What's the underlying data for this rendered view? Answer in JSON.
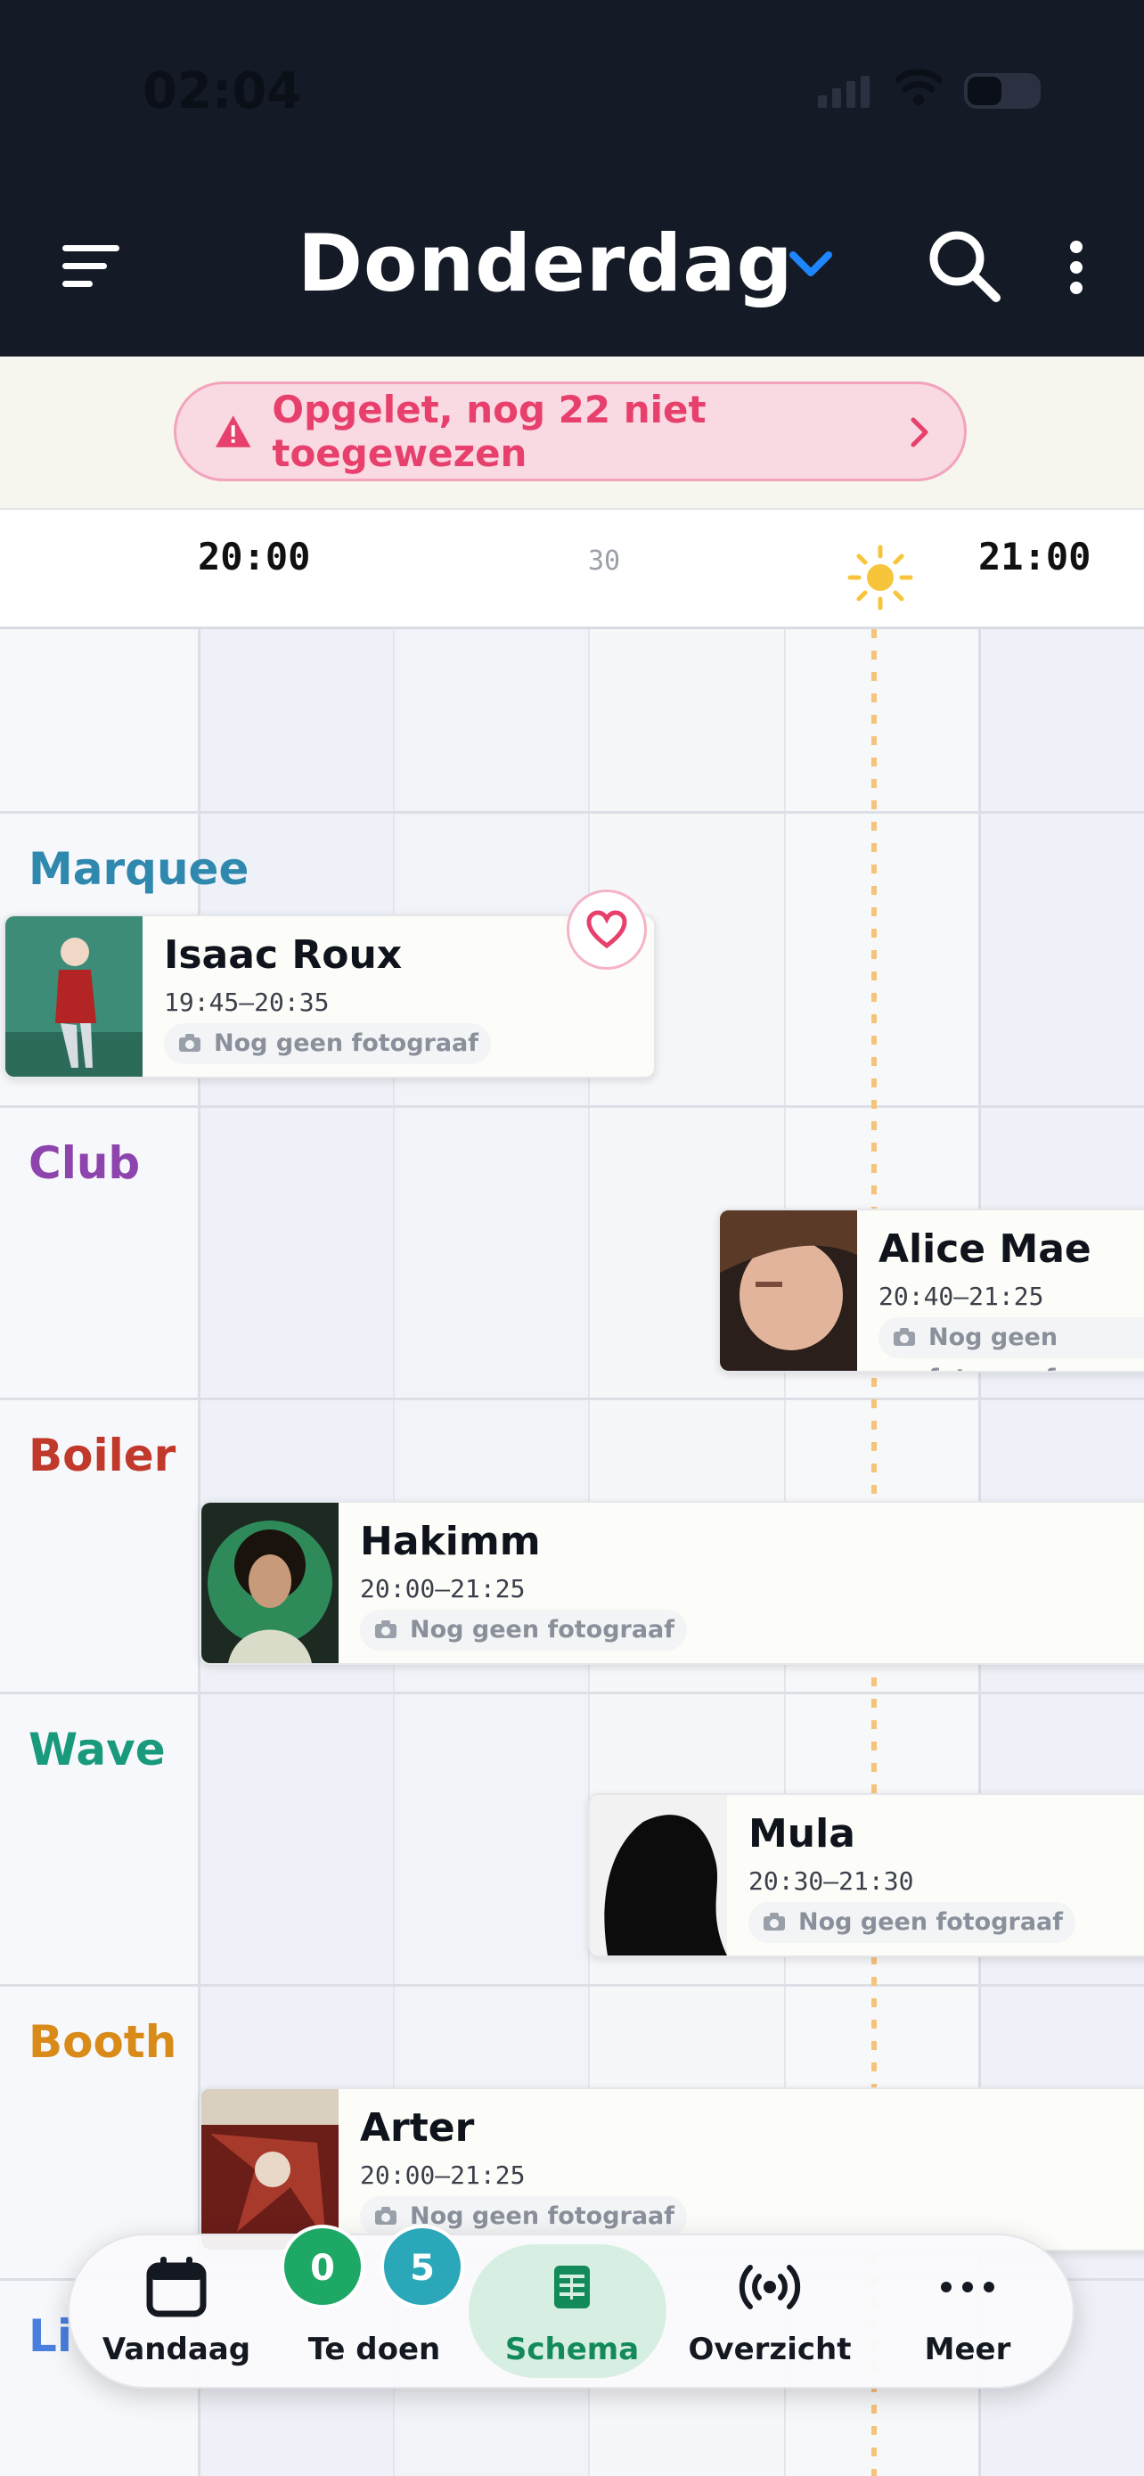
{
  "status_bar": {
    "time": "02:04"
  },
  "header": {
    "title": "Donderdag"
  },
  "alert": {
    "text": "Opgelet, nog 22 niet toegewezen"
  },
  "timeline": {
    "label_start": "20:00",
    "label_mid": "30",
    "label_end": "21:00"
  },
  "stages": [
    {
      "name": "Marquee",
      "color": "#2f88ad"
    },
    {
      "name": "Club",
      "color": "#8e44ad"
    },
    {
      "name": "Boiler",
      "color": "#c0392b"
    },
    {
      "name": "Wave",
      "color": "#1a9a7d"
    },
    {
      "name": "Booth",
      "color": "#d98b1a"
    },
    {
      "name": "Li",
      "color": "#4a7fe0"
    }
  ],
  "acts": [
    {
      "name": "Isaac Roux",
      "time": "19:45–20:35",
      "photographer": "Nog geen fotograaf",
      "favorite": true
    },
    {
      "name": "Alice Mae",
      "time": "20:40–21:25",
      "photographer": "Nog geen fotograaf"
    },
    {
      "name": "Hakimm",
      "time": "20:00–21:25",
      "photographer": "Nog geen fotograaf"
    },
    {
      "name": "Mula",
      "time": "20:30–21:30",
      "photographer": "Nog geen fotograaf"
    },
    {
      "name": "Arter",
      "time": "20:00–21:25",
      "photographer": "Nog geen fotograaf"
    }
  ],
  "nav": {
    "items": [
      {
        "label": "Vandaag",
        "icon": "calendar-icon"
      },
      {
        "label": "Te doen",
        "icon": "todo-icon"
      },
      {
        "label": "Schema",
        "icon": "schedule-icon",
        "active": true
      },
      {
        "label": "Overzicht",
        "icon": "broadcast-icon"
      },
      {
        "label": "Meer",
        "icon": "more-icon"
      }
    ],
    "badges": {
      "done": "0",
      "todo": "5"
    }
  },
  "colors": {
    "accent": "#138a5a",
    "alert": "#e8406c",
    "header_bg": "#141a26",
    "now_line": "#f6c37a"
  }
}
